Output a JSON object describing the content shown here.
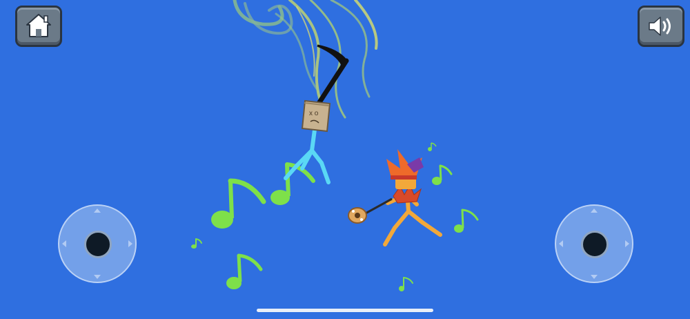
{
  "colors": {
    "background": "#2f6fe0",
    "note_green": "#7ee04a",
    "player_blue": "#5ad8f5",
    "player_orange": "#f2a83a",
    "swirl": "#9ad07a",
    "button_face": "#6b7a88"
  },
  "hud": {
    "home_button": {
      "icon": "home-icon"
    },
    "sound_button": {
      "icon": "speaker-icon"
    }
  },
  "controls": {
    "left_joystick": {
      "icon": "joystick"
    },
    "right_joystick": {
      "icon": "joystick"
    }
  },
  "characters": [
    {
      "name": "blue-stickman",
      "head": "paper-bag",
      "weapon": "scythe",
      "color": "#5ad8f5"
    },
    {
      "name": "jester-stickman",
      "head": "jester-hat",
      "weapon": "guitar",
      "color": "#f2a83a"
    }
  ]
}
